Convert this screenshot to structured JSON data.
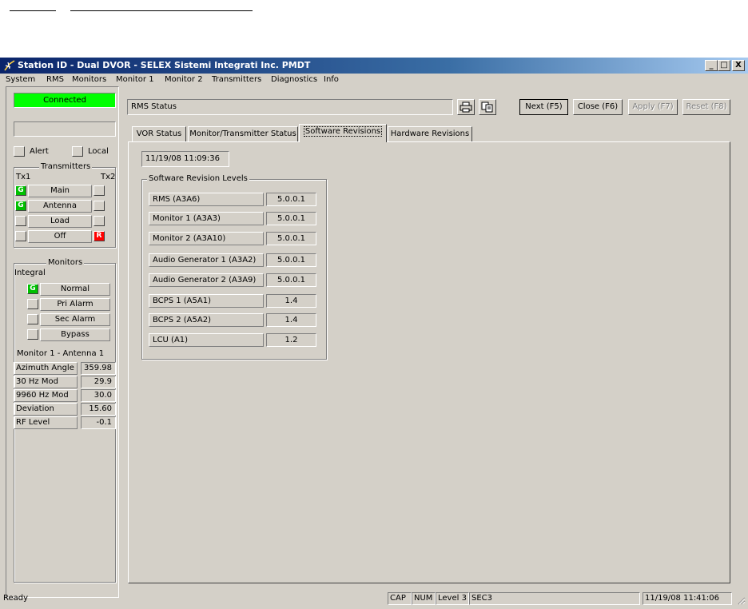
{
  "window": {
    "title": "Station ID - Dual DVOR - SELEX Sistemi Integrati Inc. PMDT"
  },
  "titlebar_buttons": {
    "minimize": "_",
    "maximize": "□",
    "close": "X"
  },
  "menu": [
    "System",
    "RMS",
    "Monitors",
    "Monitor 1",
    "Monitor 2",
    "Transmitters",
    "Diagnostics",
    "Info"
  ],
  "left_panel": {
    "connection_status": "Connected",
    "connection_color": "#00ff00",
    "alert_label": "Alert",
    "local_label": "Local",
    "transmitters": {
      "title": "Transmitters",
      "tx1": "Tx1",
      "tx2": "Tx2",
      "rows": [
        {
          "label": "Main",
          "tx1": "G",
          "tx2": ""
        },
        {
          "label": "Antenna",
          "tx1": "G",
          "tx2": ""
        },
        {
          "label": "Load",
          "tx1": "",
          "tx2": ""
        },
        {
          "label": "Off",
          "tx1": "",
          "tx2": "R"
        }
      ]
    },
    "monitors": {
      "title": "Monitors",
      "integral_label": "Integral",
      "rows": [
        {
          "label": "Normal",
          "indicator": "G"
        },
        {
          "label": "Pri Alarm",
          "indicator": ""
        },
        {
          "label": "Sec Alarm",
          "indicator": ""
        },
        {
          "label": "Bypass",
          "indicator": ""
        }
      ],
      "measurement_title": "Monitor 1 - Antenna 1",
      "measurements": [
        {
          "label": "Azimuth Angle",
          "value": "359.98"
        },
        {
          "label": "30 Hz Mod",
          "value": "29.9"
        },
        {
          "label": "9960 Hz Mod",
          "value": "30.0"
        },
        {
          "label": "Deviation",
          "value": "15.60"
        },
        {
          "label": "RF Level",
          "value": "-0.1"
        }
      ]
    }
  },
  "main": {
    "title": "RMS Status",
    "buttons": {
      "print_icon": "printer-icon",
      "copy_icon": "copy-icon",
      "next": "Next (F5)",
      "close": "Close (F6)",
      "apply": "Apply (F7)",
      "reset": "Reset (F8)"
    },
    "tabs": [
      "VOR Status",
      "Monitor/Transmitter Status",
      "Software Revisions",
      "Hardware Revisions"
    ],
    "active_tab": "Software Revisions",
    "timestamp": "11/19/08 11:09:36",
    "software_group_title": "Software Revision Levels",
    "software": [
      {
        "label": "RMS (A3A6)",
        "value": "5.0.0.1"
      },
      {
        "label": "Monitor 1 (A3A3)",
        "value": "5.0.0.1"
      },
      {
        "label": "Monitor 2 (A3A10)",
        "value": "5.0.0.1"
      },
      {
        "label": "Audio Generator 1 (A3A2)",
        "value": "5.0.0.1"
      },
      {
        "label": "Audio Generator 2 (A3A9)",
        "value": "5.0.0.1"
      },
      {
        "label": "BCPS 1 (A5A1)",
        "value": "1.4"
      },
      {
        "label": "BCPS 2 (A5A2)",
        "value": "1.4"
      },
      {
        "label": "LCU (A1)",
        "value": "1.2"
      }
    ]
  },
  "statusbar": {
    "ready": "Ready",
    "cap": "CAP",
    "num": "NUM",
    "level": "Level 3",
    "sec": "SEC3",
    "datetime": "11/19/08 11:41:06"
  }
}
